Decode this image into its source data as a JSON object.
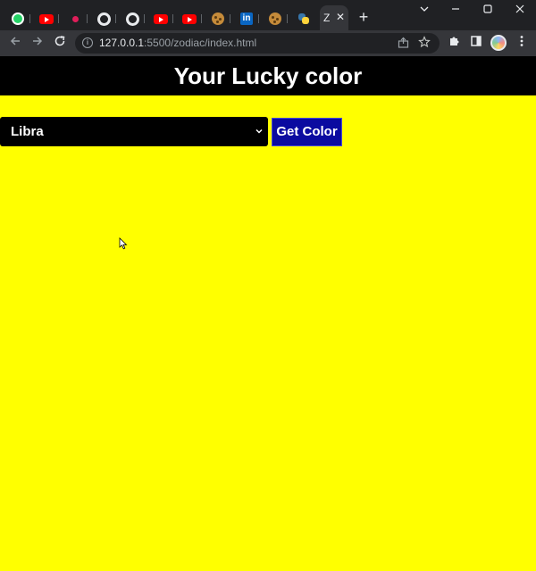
{
  "browser": {
    "active_tab_title": "Z",
    "close_glyph": "✕",
    "newtab_glyph": "+",
    "tabs": [
      {
        "icon": "whatsapp-icon"
      },
      {
        "icon": "youtube-icon"
      },
      {
        "icon": "dot-icon"
      },
      {
        "icon": "github-icon"
      },
      {
        "icon": "github-icon"
      },
      {
        "icon": "youtube-icon"
      },
      {
        "icon": "youtube-icon"
      },
      {
        "icon": "cookie-icon"
      },
      {
        "icon": "linkedin-icon",
        "letter": "in"
      },
      {
        "icon": "cookie-icon"
      },
      {
        "icon": "python-icon"
      }
    ],
    "url_host": "127.0.0.1",
    "url_path": ":5500/zodiac/index.html"
  },
  "page": {
    "title": "Your Lucky color",
    "selected_sign": "Libra",
    "button_label": "Get Color"
  },
  "colors": {
    "background": "#ffff00",
    "header": "#000000",
    "button": "#0b0ba0"
  }
}
